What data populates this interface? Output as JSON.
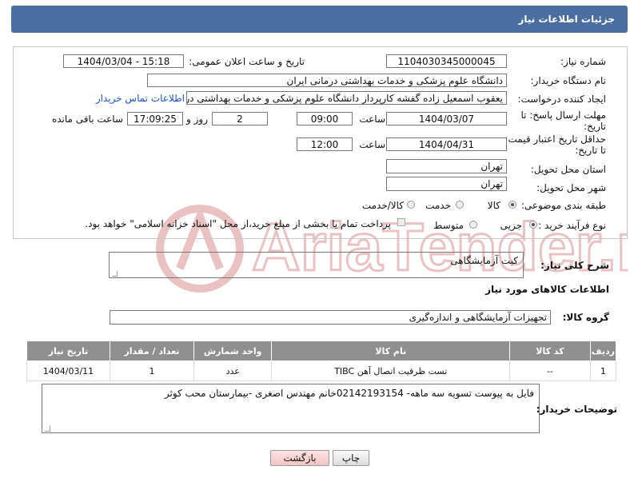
{
  "header": {
    "title": "جزئیات اطلاعات نیاز"
  },
  "form": {
    "need_number_label": "شماره نیاز:",
    "need_number": "1104030345000045",
    "announce_label": "تاریخ و ساعت اعلان عمومی:",
    "announce_value": "1404/03/04 - 15:18",
    "buyer_org_label": "نام دستگاه خریدار:",
    "buyer_org": "دانشگاه علوم پزشکی و خدمات بهداشتی درمانی ایران",
    "creator_label": "ایجاد کننده درخواست:",
    "creator": "یعقوب اسمعیل زاده گفشه کارپرداز دانشگاه علوم پزشکی و خدمات بهداشتی در",
    "contact_link": "اطلاعات تماس خریدار",
    "deadline_label_1": "مهلت ارسال پاسخ: تا",
    "deadline_label_2": "تاریخ:",
    "deadline_date": "1404/03/07",
    "time_label": "ساعت",
    "deadline_time": "09:00",
    "days_value": "2",
    "days_label": "روز و",
    "remaining_time": "17:09:25",
    "remaining_label": "ساعت باقی مانده",
    "validity_label_1": "حداقل تاریخ اعتبار قیمت:",
    "validity_label_2": "تا تاریخ:",
    "validity_date": "1404/04/31",
    "validity_time": "12:00",
    "province_label": "استان محل تحویل:",
    "province": "تهران",
    "city_label": "شهر محل تحویل:",
    "city": "تهران",
    "category_label": "طبقه بندی موضوعی:",
    "category_options": [
      "کالا",
      "خدمت",
      "کالا/خدمت"
    ],
    "process_label": "نوع فرآیند خرید :",
    "process_options": [
      "جزیی",
      "متوسط"
    ],
    "payment_note": "پرداخت تمام یا بخشی از مبلغ خرید،از محل \"اسناد خزانه اسلامی\" خواهد بود."
  },
  "description": {
    "label": "شرح کلی نیاز:",
    "value": "کیت آزمایشگاهی"
  },
  "goods": {
    "section_title": "اطلاعات کالاهای مورد نیاز",
    "group_label": "گروه کالا:",
    "group_value": "تجهیزات آزمایشگاهی و اندازه‌گیری",
    "columns": [
      "ردیف",
      "کد کالا",
      "نام کالا",
      "واحد شمارش",
      "تعداد / مقدار",
      "تاریخ نیاز"
    ],
    "rows": [
      [
        "1",
        "--",
        "تست ظرفیت اتصال آهن TIBC",
        "عدد",
        "1",
        "1404/03/11"
      ]
    ]
  },
  "buyer_notes": {
    "label": "توضیحات خریدار:",
    "value": "فایل به پیوست تسویه سه ماهه- 02142193154خانم مهندس اصغری -بیمارستان محب کوثر"
  },
  "buttons": {
    "print": "چاپ",
    "back": "بازگشت"
  },
  "watermark": {
    "text": "AriaTender.neT"
  },
  "colors": {
    "header_bg": "#4a6e9f",
    "table_header_bg": "#8f8f8f",
    "link": "#1a55c4",
    "watermark": "#e7bcbc"
  }
}
